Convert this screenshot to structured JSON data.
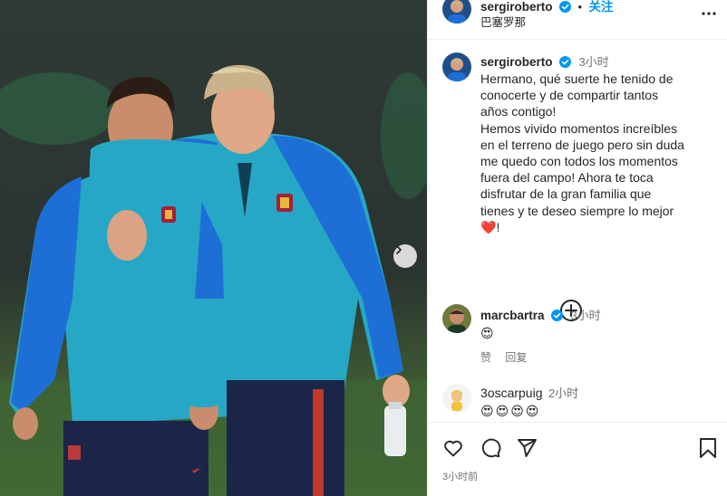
{
  "post": {
    "username": "sergiroberto",
    "follow_label": "关注",
    "location": "巴塞罗那",
    "posted_ago": "3小时前"
  },
  "caption": {
    "username": "sergiroberto",
    "time": "3小时",
    "text": "Hermano, qué suerte he tenido de\nconocerte y de compartir tantos\naños contigo!\nHemos vivido momentos increíbles\nen el terreno de juego pero sin duda\nme quedo con todos los momentos\nfuera del campo! Ahora te toca\ndisfrutar de la gran familia que\ntienes y te deseo siempre lo mejor",
    "trailing_emoji": "❤️",
    "trailing_text": "!"
  },
  "comments": [
    {
      "username": "marcbartra",
      "verified": true,
      "time": "3小时",
      "text": "😍",
      "like_label": "赞",
      "reply_label": "回复"
    },
    {
      "username": "3oscarpuig",
      "verified": false,
      "time": "2小时",
      "text": "😍😍😍😍"
    }
  ],
  "colors": {
    "accent": "#0095f6",
    "verified": "#0095f6",
    "muted": "#737373",
    "border": "#efefef"
  },
  "icons": {
    "more": "more-icon",
    "next": "chevron-right-icon",
    "load_more": "plus-circle-icon",
    "like": "heart-icon",
    "comment": "comment-icon",
    "share": "share-icon",
    "save": "bookmark-icon"
  }
}
